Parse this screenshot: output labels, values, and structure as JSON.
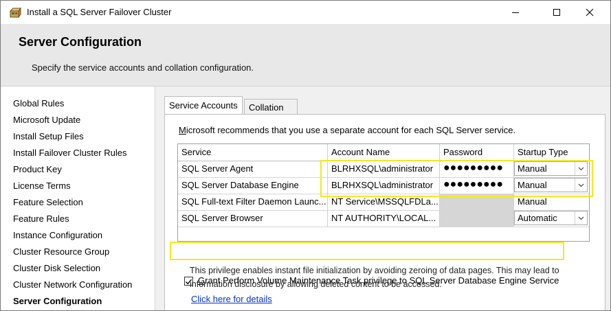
{
  "window": {
    "title": "Install a SQL Server Failover Cluster",
    "minimize": "—",
    "maximize": "☐",
    "close": "✕"
  },
  "header": {
    "title": "Server Configuration",
    "subtitle": "Specify the service accounts and collation configuration."
  },
  "nav": {
    "items": [
      {
        "label": "Global Rules"
      },
      {
        "label": "Microsoft Update"
      },
      {
        "label": "Install Setup Files"
      },
      {
        "label": "Install Failover Cluster Rules"
      },
      {
        "label": "Product Key"
      },
      {
        "label": "License Terms"
      },
      {
        "label": "Feature Selection"
      },
      {
        "label": "Feature Rules"
      },
      {
        "label": "Instance Configuration"
      },
      {
        "label": "Cluster Resource Group"
      },
      {
        "label": "Cluster Disk Selection"
      },
      {
        "label": "Cluster Network Configuration"
      },
      {
        "label": "Server Configuration"
      }
    ],
    "active_index": 12
  },
  "tabs": {
    "service_accounts": "Service Accounts",
    "collation": "Collation"
  },
  "service_accounts": {
    "recommend_first": "M",
    "recommend_rest": "icrosoft recommends that you use a separate account for each SQL Server service.",
    "columns": [
      "Service",
      "Account Name",
      "Password",
      "Startup Type"
    ],
    "rows": [
      {
        "service": "SQL Server Agent",
        "account": "BLRHXSQL\\administrator",
        "password": "●●●●●●●●●",
        "startup": "Manual"
      },
      {
        "service": "SQL Server Database Engine",
        "account": "BLRHXSQL\\administrator",
        "password": "●●●●●●●●●",
        "startup": "Manual"
      },
      {
        "service": "SQL Full-text Filter Daemon Launc...",
        "account": "NT Service\\MSSQLFDLa...",
        "password": "",
        "startup": "Manual"
      },
      {
        "service": "SQL Server Browser",
        "account": "NT AUTHORITY\\LOCAL...",
        "password": "",
        "startup": "Automatic"
      }
    ],
    "grant_checkbox": {
      "checked": true,
      "label_first": "G",
      "label_rest": "rant Perform Volume Maintenance Task privilege to SQL Server Database Engine Service"
    },
    "description": "This privilege enables instant file initialization by avoiding zeroing of data pages. This may lead to information disclosure by allowing deleted content to be accessed.",
    "details_link": "Click here for details"
  },
  "colors": {
    "highlight": "#f4e81f",
    "header_bg": "#e8e8e8",
    "panel_bg": "#f0f0f0",
    "link": "#0033cc",
    "readonly_cell": "#d6d6d6"
  },
  "icons": {
    "app": "setup-box-icon",
    "dropdown": "chevron-down-icon",
    "check": "checkmark-icon"
  }
}
